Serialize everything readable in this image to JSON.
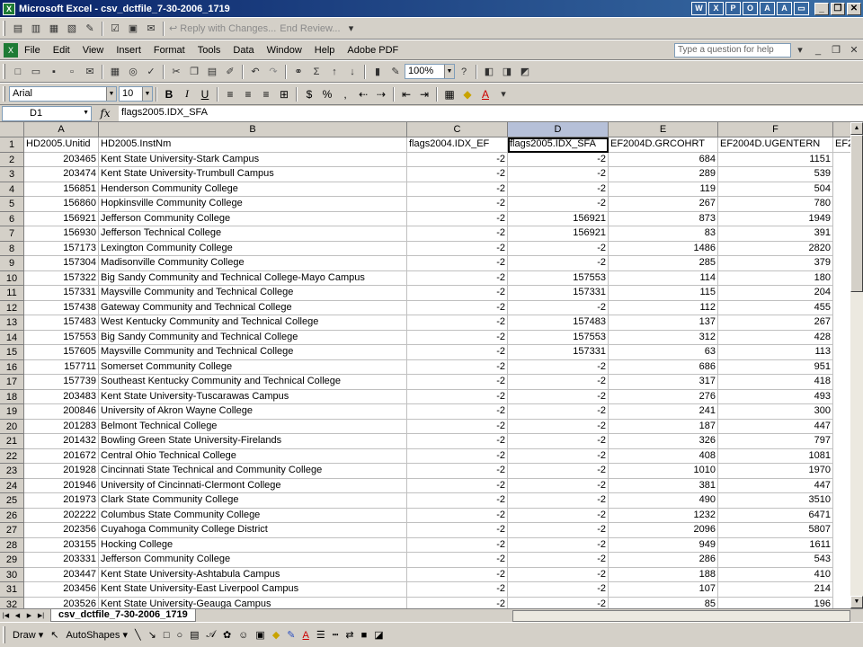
{
  "window": {
    "title": "Microsoft Excel - csv_dctfile_7-30-2006_1719",
    "app_icon": "excel-icon"
  },
  "reviewing": {
    "reply": "Reply with Changes...",
    "end_review": "End Review..."
  },
  "menu": {
    "items": [
      "File",
      "Edit",
      "View",
      "Insert",
      "Format",
      "Tools",
      "Data",
      "Window",
      "Help",
      "Adobe PDF"
    ],
    "help_placeholder": "Type a question for help"
  },
  "standard": {
    "zoom": "100%",
    "sigma": "Σ"
  },
  "formatting": {
    "font": "Arial",
    "size": "10",
    "bold": "B",
    "italic": "I",
    "underline": "U",
    "currency": "$",
    "percent": "%",
    "font_color_letter": "A"
  },
  "formula": {
    "cell_ref": "D1",
    "fx": "fx",
    "value": "flags2005.IDX_SFA"
  },
  "grid": {
    "columns": [
      "A",
      "B",
      "C",
      "D",
      "E",
      "F"
    ],
    "selected_column": "D",
    "headers": [
      "HD2005.Unitid",
      "HD2005.InstNm",
      "flags2004.IDX_EF",
      "flags2005.IDX_SFA",
      "EF2004D.GRCOHRT",
      "EF2004D.UGENTERN",
      "EF2"
    ],
    "rows": [
      [
        "2",
        "203465",
        "Kent State University-Stark Campus",
        "-2",
        "-2",
        "684",
        "1151"
      ],
      [
        "3",
        "203474",
        "Kent State University-Trumbull Campus",
        "-2",
        "-2",
        "289",
        "539"
      ],
      [
        "4",
        "156851",
        "Henderson Community College",
        "-2",
        "-2",
        "119",
        "504"
      ],
      [
        "5",
        "156860",
        "Hopkinsville Community College",
        "-2",
        "-2",
        "267",
        "780"
      ],
      [
        "6",
        "156921",
        "Jefferson Community College",
        "-2",
        "156921",
        "873",
        "1949"
      ],
      [
        "7",
        "156930",
        "Jefferson Technical College",
        "-2",
        "156921",
        "83",
        "391"
      ],
      [
        "8",
        "157173",
        "Lexington Community College",
        "-2",
        "-2",
        "1486",
        "2820"
      ],
      [
        "9",
        "157304",
        "Madisonville Community College",
        "-2",
        "-2",
        "285",
        "379"
      ],
      [
        "10",
        "157322",
        "Big Sandy Community and Technical College-Mayo Campus",
        "-2",
        "157553",
        "114",
        "180"
      ],
      [
        "11",
        "157331",
        "Maysville Community and Technical College",
        "-2",
        "157331",
        "115",
        "204"
      ],
      [
        "12",
        "157438",
        "Gateway Community and Technical College",
        "-2",
        "-2",
        "112",
        "455"
      ],
      [
        "13",
        "157483",
        "West Kentucky Community and Technical College",
        "-2",
        "157483",
        "137",
        "267"
      ],
      [
        "14",
        "157553",
        "Big Sandy Community and Technical College",
        "-2",
        "157553",
        "312",
        "428"
      ],
      [
        "15",
        "157605",
        "Maysville Community and Technical College",
        "-2",
        "157331",
        "63",
        "113"
      ],
      [
        "16",
        "157711",
        "Somerset Community College",
        "-2",
        "-2",
        "686",
        "951"
      ],
      [
        "17",
        "157739",
        "Southeast Kentucky Community and Technical College",
        "-2",
        "-2",
        "317",
        "418"
      ],
      [
        "18",
        "203483",
        "Kent State University-Tuscarawas Campus",
        "-2",
        "-2",
        "276",
        "493"
      ],
      [
        "19",
        "200846",
        "University of Akron Wayne College",
        "-2",
        "-2",
        "241",
        "300"
      ],
      [
        "20",
        "201283",
        "Belmont Technical College",
        "-2",
        "-2",
        "187",
        "447"
      ],
      [
        "21",
        "201432",
        "Bowling Green State University-Firelands",
        "-2",
        "-2",
        "326",
        "797"
      ],
      [
        "22",
        "201672",
        "Central Ohio Technical College",
        "-2",
        "-2",
        "408",
        "1081"
      ],
      [
        "23",
        "201928",
        "Cincinnati State Technical and Community College",
        "-2",
        "-2",
        "1010",
        "1970"
      ],
      [
        "24",
        "201946",
        "University of Cincinnati-Clermont College",
        "-2",
        "-2",
        "381",
        "447"
      ],
      [
        "25",
        "201973",
        "Clark State Community College",
        "-2",
        "-2",
        "490",
        "3510"
      ],
      [
        "26",
        "202222",
        "Columbus State Community College",
        "-2",
        "-2",
        "1232",
        "6471"
      ],
      [
        "27",
        "202356",
        "Cuyahoga Community College District",
        "-2",
        "-2",
        "2096",
        "5807"
      ],
      [
        "28",
        "203155",
        "Hocking College",
        "-2",
        "-2",
        "949",
        "1611"
      ],
      [
        "29",
        "203331",
        "Jefferson Community College",
        "-2",
        "-2",
        "286",
        "543"
      ],
      [
        "30",
        "203447",
        "Kent State University-Ashtabula Campus",
        "-2",
        "-2",
        "188",
        "410"
      ],
      [
        "31",
        "203456",
        "Kent State University-East Liverpool Campus",
        "-2",
        "-2",
        "107",
        "214"
      ],
      [
        "32",
        "203526",
        "Kent State University-Geauga Campus",
        "-2",
        "-2",
        "85",
        "196"
      ]
    ]
  },
  "sheet": {
    "tab": "csv_dctfile_7-30-2006_1719"
  },
  "drawing": {
    "draw": "Draw",
    "autoshapes": "AutoShapes"
  }
}
